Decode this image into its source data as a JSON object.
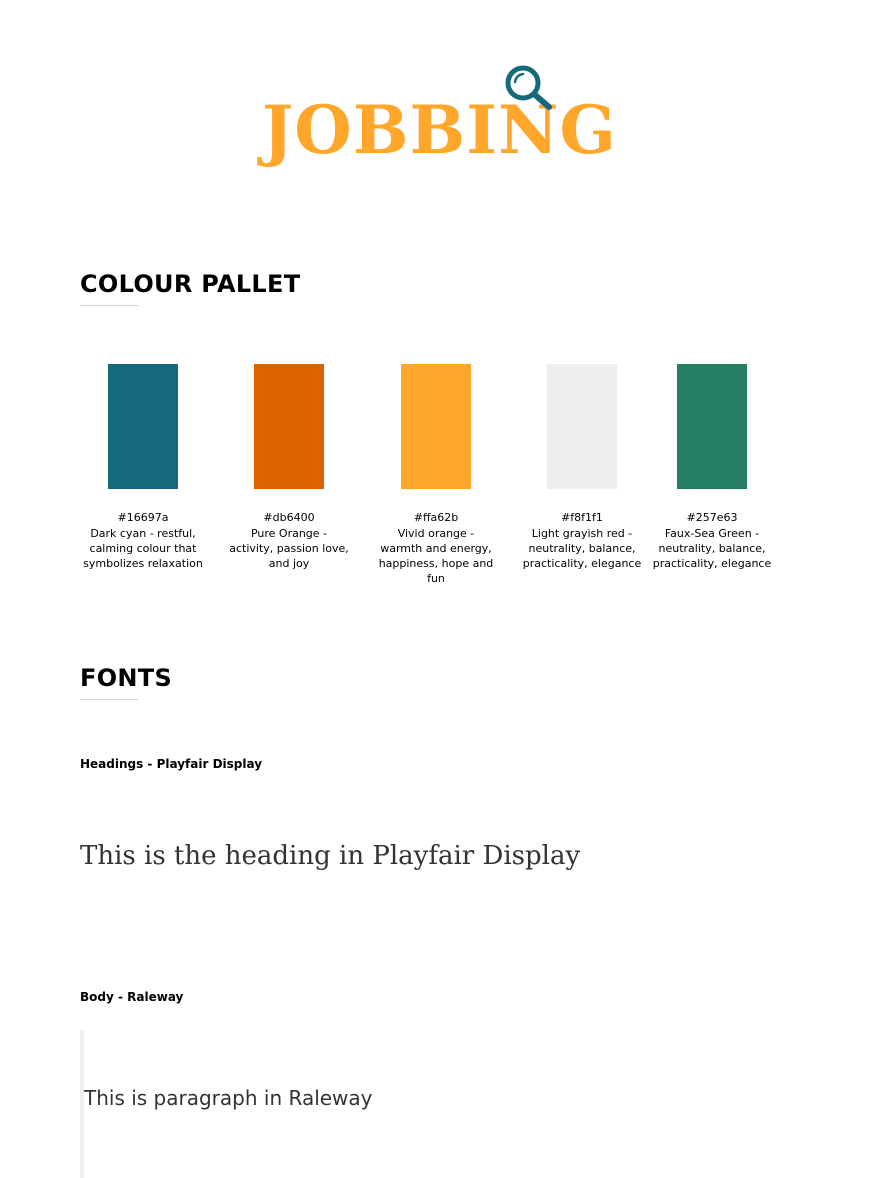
{
  "logo": {
    "text": "JOBBING",
    "icon": "magnifying-glass-icon",
    "text_color": "#ffa62b",
    "icon_color": "#16697a"
  },
  "colour_section": {
    "title": "COLOUR PALLET",
    "swatches": [
      {
        "color": "#16697a",
        "hex": "#16697a",
        "description": "Dark cyan - restful, calming colour that symbolizes relaxation"
      },
      {
        "color": "#db6400",
        "hex": "#db6400",
        "description": "Pure Orange - activity, passion love, and joy"
      },
      {
        "color": "#ffa62b",
        "hex": "#ffa62b",
        "description": "Vivid orange - warmth and energy, happiness, hope and fun"
      },
      {
        "color": "#eeeeee",
        "hex": "#f8f1f1",
        "description": "Light grayish red - neutrality, balance, practicality, elegance"
      },
      {
        "color": "#257e63",
        "hex": "#257e63",
        "description": "Faux-Sea Green - neutrality, balance, practicality, elegance"
      }
    ]
  },
  "fonts_section": {
    "title": "FONTS",
    "headings_label": "Headings - Playfair Display",
    "heading_sample": "This is the heading in Playfair Display",
    "body_label": "Body - Raleway",
    "paragraph_sample": "This is paragraph in Raleway"
  }
}
